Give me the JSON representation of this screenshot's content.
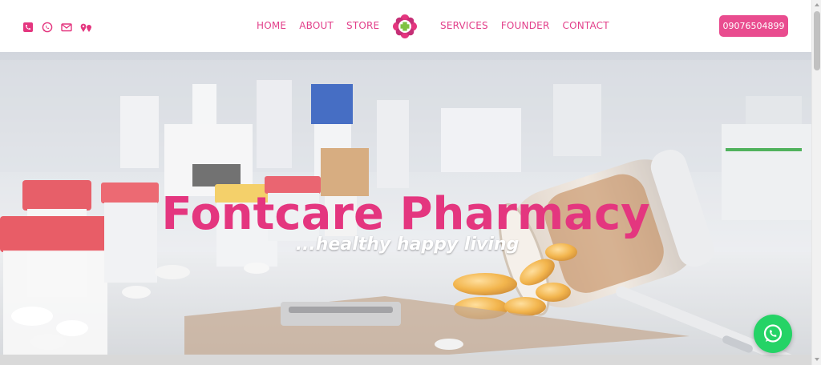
{
  "header": {
    "social_icons": [
      "phone-icon",
      "whatsapp-icon",
      "mail-icon",
      "location-icon"
    ],
    "nav_left": [
      {
        "label": "HOME"
      },
      {
        "label": "ABOUT"
      },
      {
        "label": "STORE"
      }
    ],
    "nav_right": [
      {
        "label": "SERVICES"
      },
      {
        "label": "FOUNDER"
      },
      {
        "label": "CONTACT"
      }
    ],
    "phone_label": "09076504899"
  },
  "hero": {
    "title": "Fontcare Pharmacy",
    "subtitle": "...healthy happy living"
  },
  "colors": {
    "brand": "#e4367f",
    "button": "#e94c8f",
    "whatsapp": "#25d366"
  }
}
